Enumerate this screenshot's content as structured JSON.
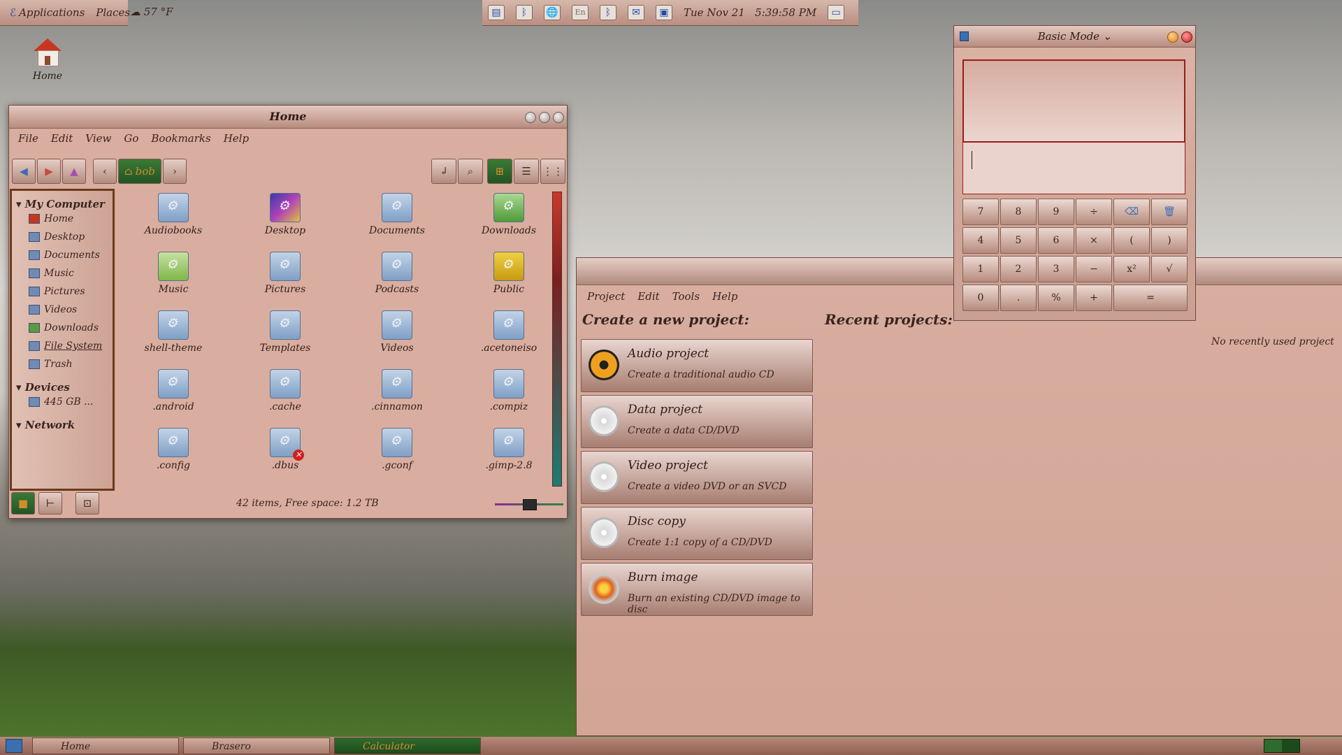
{
  "top_left_panel": {
    "applications": "Applications",
    "places": "Places",
    "weather": "57 °F"
  },
  "top_right_panel": {
    "datetime": "Tue Nov 21   5:39:58 PM",
    "icons": [
      "clipboard-icon",
      "bluetooth-icon",
      "network-icon",
      "keyboard-layout-icon",
      "bluetooth-icon",
      "mail-icon",
      "network-monitor-icon",
      "display-icon"
    ],
    "keyboard_layout": "En"
  },
  "desktop": {
    "home_label": "Home"
  },
  "files_window": {
    "title": "Home",
    "menu": [
      "File",
      "Edit",
      "View",
      "Go",
      "Bookmarks",
      "Help"
    ],
    "path_button": "bob",
    "sidebar": {
      "my_computer": "My Computer",
      "places": [
        "Home",
        "Desktop",
        "Documents",
        "Music",
        "Pictures",
        "Videos",
        "Downloads",
        "File System",
        "Trash"
      ],
      "devices": "Devices",
      "device_items": [
        "445 GB ..."
      ],
      "network": "Network"
    },
    "items": [
      "Audiobooks",
      "Desktop",
      "Documents",
      "Downloads",
      "Music",
      "Pictures",
      "Podcasts",
      "Public",
      "shell-theme",
      "Templates",
      "Videos",
      ".acetoneiso",
      ".android",
      ".cache",
      ".cinnamon",
      ".compiz",
      ".config",
      ".dbus",
      ".gconf",
      ".gimp-2.8"
    ],
    "status": "42 items, Free space: 1.2 TB"
  },
  "brasero": {
    "menu": [
      "Project",
      "Edit",
      "Tools",
      "Help"
    ],
    "create_heading": "Create a new project:",
    "recent_heading": "Recent projects:",
    "no_recent": "No recently used project",
    "projects": [
      {
        "title": "Audio project",
        "subtitle": "Create a traditional audio CD"
      },
      {
        "title": "Data project",
        "subtitle": "Create a data CD/DVD"
      },
      {
        "title": "Video project",
        "subtitle": "Create a video DVD or an SVCD"
      },
      {
        "title": "Disc copy",
        "subtitle": "Create 1:1 copy of a CD/DVD"
      },
      {
        "title": "Burn image",
        "subtitle": "Burn an existing CD/DVD image to disc"
      }
    ]
  },
  "calculator": {
    "title": "Basic Mode",
    "keys": [
      "7",
      "8",
      "9",
      "÷",
      "⌫",
      "🗑",
      "4",
      "5",
      "6",
      "×",
      "(",
      ")",
      "1",
      "2",
      "3",
      "−",
      "x²",
      "√",
      "0",
      ".",
      "%",
      "+",
      "="
    ]
  },
  "taskbar": {
    "items": [
      "Home",
      "Brasero",
      "Calculator"
    ]
  }
}
